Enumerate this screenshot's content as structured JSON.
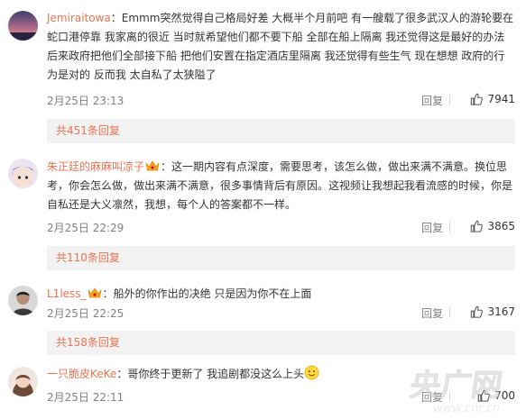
{
  "comments": [
    {
      "username": "Jemiraitowa",
      "sep": "：",
      "text": "Emmm突然觉得自己格局好差 大概半个月前吧 有一艘载了很多武汉人的游轮要在蛇口港停靠 我家离的很近 当时就希望他们都不要下船 全部在船上隔离 我还觉得这是最好的办法 后来政府把他们全部接下船 把他们安置在指定酒店里隔离 我还觉得有些生气 现在想想 政府的行为是对的 反而我 太自私了太狭隘了",
      "date": "2月25日 23:13",
      "reply_label": "回复",
      "likes": "7941",
      "replies_label": "共451条回复"
    },
    {
      "username": "朱正廷的麻麻叫凉子",
      "sep": "：",
      "text": "这一期内容有点深度，需要思考，该怎么做，做出来满不满意。换位思考，你会怎么做，做出来满不满意，很多事情背后有原因。这视频让我想起我看流感的时候，你是自私还是大义凛然，我想，每个人的答案都不一样。",
      "date": "2月25日 22:29",
      "reply_label": "回复",
      "likes": "3865",
      "replies_label": "共110条回复"
    },
    {
      "username": "L1less_",
      "sep": "：",
      "text": "船外的你作出的决绝 只是因为你不在上面",
      "date": "2月25日 22:25",
      "reply_label": "回复",
      "likes": "3167",
      "replies_label": "共158条回复"
    },
    {
      "username": "一只脆皮KeKe",
      "sep": "：",
      "text": "哥你终于更新了 我追剧都没这么上头",
      "date": "2月25日 22:11",
      "reply_label": "回复",
      "likes": "700"
    }
  ],
  "watermark": {
    "text": "央广网",
    "sub": "www.cnr.cn"
  },
  "colors": {
    "username": "#eb7350",
    "meta": "#808080",
    "replies_bg": "#f2f2f2"
  },
  "icons": [
    "thumbs-up-icon",
    "vip-badge-icon",
    "smiling-face-icon"
  ]
}
